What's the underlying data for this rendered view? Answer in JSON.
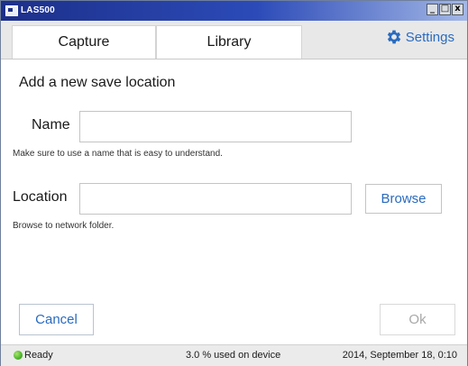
{
  "window": {
    "title": "LAS500",
    "controls": [
      "_",
      "□",
      "x"
    ]
  },
  "tabs": {
    "capture": "Capture",
    "library": "Library"
  },
  "settings": {
    "label": "Settings",
    "icon": "gear-icon"
  },
  "form": {
    "heading": "Add a new save location",
    "name": {
      "label": "Name",
      "value": "",
      "hint": "Make sure to use a name that is easy to understand."
    },
    "location": {
      "label": "Location",
      "value": "",
      "hint": "Browse to network folder.",
      "browse_label": "Browse"
    }
  },
  "actions": {
    "cancel_label": "Cancel",
    "ok_label": "Ok"
  },
  "status": {
    "state": "Ready",
    "usage": "3.0 % used on device",
    "datetime": "2014, September 18, 0:10",
    "colors": {
      "ready": "#4bb52a",
      "accent": "#2a6bbf"
    }
  }
}
